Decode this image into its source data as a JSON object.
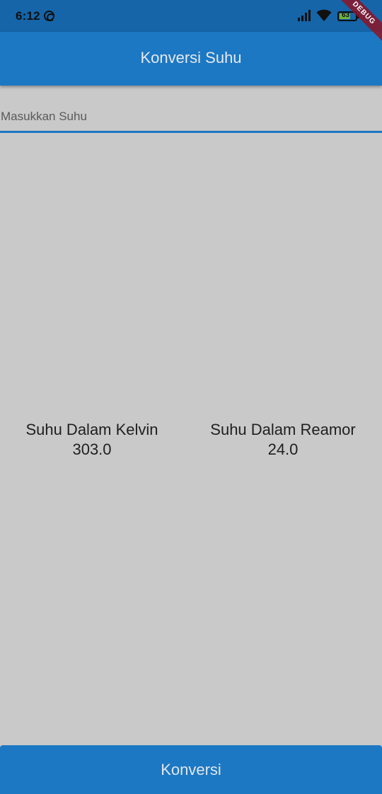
{
  "status_bar": {
    "time": "6:12",
    "battery_text": "63",
    "battery_level": 0.63,
    "icons": [
      "sync-icon",
      "signal-icon",
      "wifi-icon",
      "battery-icon"
    ]
  },
  "debug_banner": "DEBUG",
  "app_bar": {
    "title": "Konversi Suhu"
  },
  "input": {
    "placeholder": "Masukkan Suhu",
    "value": ""
  },
  "results": {
    "kelvin": {
      "label": "Suhu Dalam Kelvin",
      "value": "303.0"
    },
    "reamur": {
      "label": "Suhu Dalam Reamor",
      "value": "24.0"
    }
  },
  "convert_button": {
    "label": "Konversi"
  },
  "colors": {
    "primary": "#1c78c3",
    "status_bar": "#1565a8",
    "background": "#c9c9c9"
  }
}
